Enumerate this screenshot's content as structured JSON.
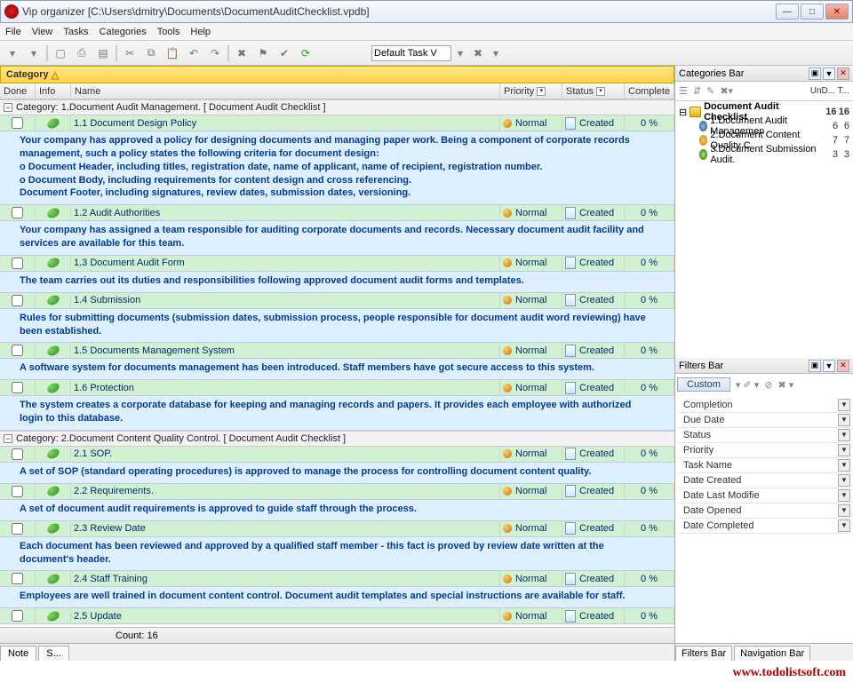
{
  "window": {
    "title": "Vip organizer [C:\\Users\\dmitry\\Documents\\DocumentAuditChecklist.vpdb]"
  },
  "menu": {
    "file": "File",
    "view": "View",
    "tasks": "Tasks",
    "categories": "Categories",
    "tools": "Tools",
    "help": "Help"
  },
  "toolbar": {
    "task_mode": "Default Task V"
  },
  "grid": {
    "category_label": "Category",
    "headers": {
      "done": "Done",
      "info": "Info",
      "name": "Name",
      "priority": "Priority",
      "status": "Status",
      "complete": "Complete"
    },
    "count_label": "Count: 16"
  },
  "cats": [
    {
      "label": "Category: 1.Document Audit Management.   [ Document Audit Checklist ]",
      "tasks": [
        {
          "name": "1.1 Document Design Policy",
          "priority": "Normal",
          "status": "Created",
          "complete": "0 %",
          "note": "Your company has approved a policy for designing documents and managing paper work. Being a component of corporate records management, such a policy states the following criteria for document design:\no       Document Header, including titles, registration date, name of applicant, name of recipient, registration number.\no       Document Body, including requirements for content design and cross referencing.\nDocument Footer, including signatures, review dates, submission dates, versioning."
        },
        {
          "name": "1.2 Audit Authorities",
          "priority": "Normal",
          "status": "Created",
          "complete": "0 %",
          "note": "Your company has assigned a team responsible for auditing corporate documents and records. Necessary document audit facility and services are available for this team."
        },
        {
          "name": "1.3 Document Audit Form",
          "priority": "Normal",
          "status": "Created",
          "complete": "0 %",
          "note": "The team carries out its duties and responsibilities following approved document audit forms and templates."
        },
        {
          "name": "1.4 Submission",
          "priority": "Normal",
          "status": "Created",
          "complete": "0 %",
          "note": "Rules for submitting documents (submission dates, submission process, people responsible for document audit word reviewing) have been established."
        },
        {
          "name": "1.5 Documents Management System",
          "priority": "Normal",
          "status": "Created",
          "complete": "0 %",
          "note": "A software system for documents management <http://www.todolistsoft.com/solutions/checklist/electronic-records-management-checklist.php> has been introduced. Staff members have got secure access to this system."
        },
        {
          "name": "1.6 Protection",
          "priority": "Normal",
          "status": "Created",
          "complete": "0 %",
          "note": "The system creates a corporate database for keeping and managing records and papers. It provides each employee with authorized login to this database."
        }
      ]
    },
    {
      "label": "Category: 2.Document Content Quality Control.   [ Document Audit Checklist ]",
      "tasks": [
        {
          "name": "2.1 SOP.",
          "priority": "Normal",
          "status": "Created",
          "complete": "0 %",
          "note": "A set of SOP (standard operating procedures) is approved to manage the process for controlling document content quality."
        },
        {
          "name": "2.2 Requirements.",
          "priority": "Normal",
          "status": "Created",
          "complete": "0 %",
          "note": "A set of document audit requirements is approved to guide staff through the process."
        },
        {
          "name": "2.3 Review Date",
          "priority": "Normal",
          "status": "Created",
          "complete": "0 %",
          "note": "Each document has been reviewed and approved by a qualified staff member - this fact is proved by review date written at the document's header."
        },
        {
          "name": "2.4 Staff Training",
          "priority": "Normal",
          "status": "Created",
          "complete": "0 %",
          "note": "Employees are well trained in document content control. Document audit templates and special instructions are available for staff."
        },
        {
          "name": "2.5 Update",
          "priority": "Normal",
          "status": "Created",
          "complete": "0 %",
          "note": ""
        }
      ]
    }
  ],
  "bottom_tabs": {
    "note": "Note",
    "s": "S..."
  },
  "categories_bar": {
    "title": "Categories Bar",
    "cols": "UnD...  T...",
    "root": {
      "label": "Document Audit Checklist",
      "a": "16",
      "b": "16"
    },
    "items": [
      {
        "label": "1.Document Audit Managemen",
        "a": "6",
        "b": "6"
      },
      {
        "label": "2.Document Content Quality C",
        "a": "7",
        "b": "7"
      },
      {
        "label": "3.Document Submission Audit.",
        "a": "3",
        "b": "3"
      }
    ]
  },
  "filters_bar": {
    "title": "Filters Bar",
    "custom": "Custom",
    "rows": [
      "Completion",
      "Due Date",
      "Status",
      "Priority",
      "Task Name",
      "Date Created",
      "Date Last Modifie",
      "Date Opened",
      "Date Completed"
    ],
    "tabs": {
      "filters": "Filters Bar",
      "nav": "Navigation Bar"
    }
  },
  "watermark": "www.todolistsoft.com"
}
